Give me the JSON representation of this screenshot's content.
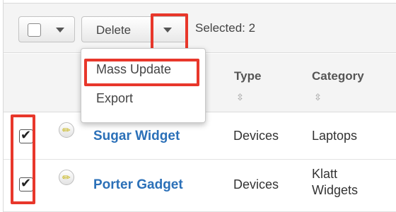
{
  "toolbar": {
    "delete_label": "Delete",
    "selected_text": "Selected: 2"
  },
  "menu": {
    "items": [
      {
        "label": "Mass Update"
      },
      {
        "label": "Export"
      }
    ]
  },
  "table": {
    "columns": [
      {
        "label": "Type"
      },
      {
        "label": "Category"
      }
    ],
    "sort_glyph": "⇳",
    "rows": [
      {
        "name": "Sugar Widget",
        "type": "Devices",
        "category": "Laptops",
        "checked": true
      },
      {
        "name": "Porter Gadget",
        "type": "Devices",
        "category_lines": [
          "Klatt",
          "Widgets"
        ],
        "checked": true
      }
    ]
  },
  "colors": {
    "highlight": "#e8372b",
    "link": "#2b70b8",
    "toolbar_bg": "#f4f4f4"
  },
  "icons": {
    "check": "✔",
    "pencil": "✏"
  }
}
